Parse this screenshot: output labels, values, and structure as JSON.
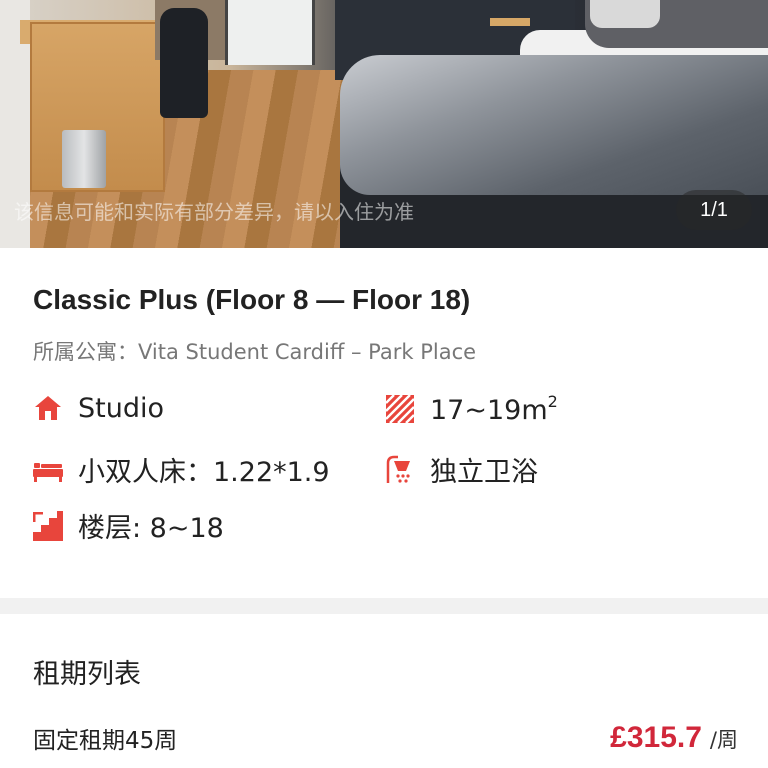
{
  "hero": {
    "watermark": "该信息可能和实际有部分差异，请以入住为准",
    "counter": "1/1"
  },
  "room": {
    "title": "Classic Plus (Floor 8 — Floor 18)",
    "apartment": "所属公寓：Vita Student Cardiff – Park Place"
  },
  "features": [
    {
      "icon": "house-icon",
      "text": "Studio"
    },
    {
      "icon": "area-icon",
      "text": "17~19m",
      "sup": "2"
    },
    {
      "icon": "bed-icon",
      "text": "小双人床：1.22*1.9"
    },
    {
      "icon": "shower-icon",
      "text": "独立卫浴"
    },
    {
      "icon": "stairs-icon",
      "text": "楼层: 8~18"
    }
  ],
  "lease": {
    "heading": "租期列表",
    "items": [
      {
        "label": "固定租期45周",
        "price": "£315.7",
        "unit": "/周"
      }
    ]
  },
  "colors": {
    "accent": "#e8453c",
    "price": "#d1273a"
  }
}
